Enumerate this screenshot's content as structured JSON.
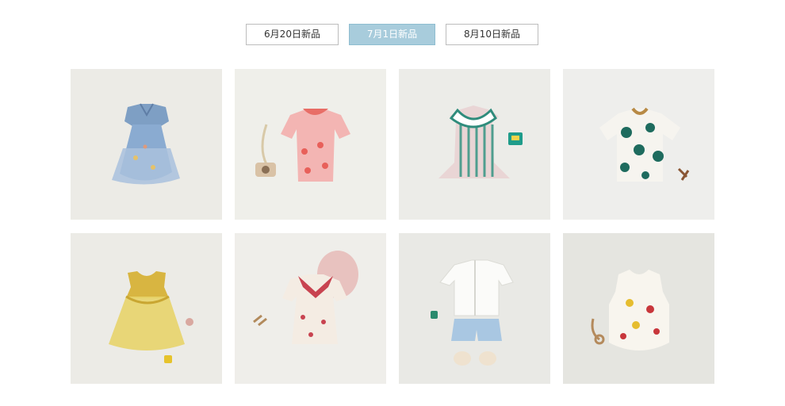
{
  "tabs": [
    {
      "label": "6月20日新品",
      "active": false
    },
    {
      "label": "7月1日新品",
      "active": true
    },
    {
      "label": "8月10日新品",
      "active": false
    }
  ],
  "colors": {
    "tab_active_bg": "#a8ccdc",
    "card_bg": [
      "#ecebe6",
      "#efefea",
      "#ecece8",
      "#eeeeec",
      "#ecebe6",
      "#efeeea",
      "#e9e9e5",
      "#e5e5e0"
    ]
  },
  "products": [
    {
      "item": "blue-tulle-dress"
    },
    {
      "item": "pink-peach-dress"
    },
    {
      "item": "striped-sailor-top-set"
    },
    {
      "item": "polka-dot-tee"
    },
    {
      "item": "yellow-tulle-dress"
    },
    {
      "item": "cream-sailor-dress"
    },
    {
      "item": "white-shirt-shorts-set"
    },
    {
      "item": "fruit-print-romper"
    }
  ]
}
